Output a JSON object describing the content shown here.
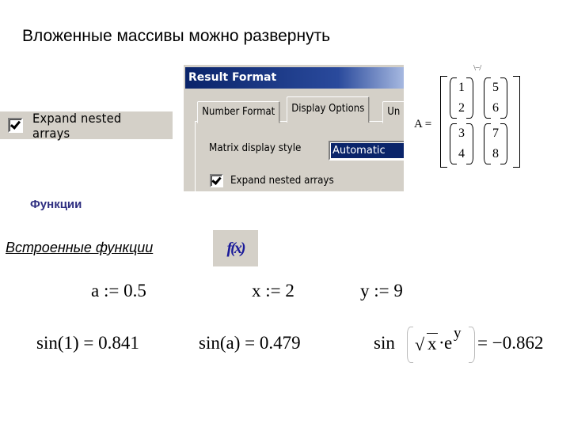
{
  "slide": {
    "title": "Вложенные массивы можно развернуть"
  },
  "left_checkbox": {
    "label": "Expand nested arrays",
    "checked": true
  },
  "dialog": {
    "title": "Result Format",
    "tabs": [
      {
        "label": "Number Format",
        "active": false
      },
      {
        "label": "Display Options",
        "active": true
      },
      {
        "label": "Un",
        "active": false
      }
    ],
    "matrix_style_label": "Matrix display style",
    "matrix_style_value": "Automatic",
    "expand_label": "Expand nested arrays",
    "expand_checked": true
  },
  "matrix": {
    "label": "A =",
    "top_fragment": "\\−/",
    "cells": [
      [
        "1",
        "2"
      ],
      [
        "5",
        "6"
      ],
      [
        "3",
        "4"
      ],
      [
        "7",
        "8"
      ]
    ]
  },
  "section": {
    "title": "Функции"
  },
  "builtin": {
    "title": "Встроенные функции",
    "button_glyph": "f(x)",
    "button_icon": "insert-function-icon"
  },
  "math": {
    "assign_a": "a := 0.5",
    "assign_x": "x := 2",
    "assign_y": "y := 9",
    "sin1": "sin(1) = 0.841",
    "sina": "sin(a) = 0.479",
    "sin3_fn": "sin",
    "sin3_sqrt": "√",
    "sin3_rad": "x",
    "sin3_dot": "·",
    "sin3_e": "e",
    "sin3_sup": "y",
    "sin3_result": "= −0.862"
  },
  "colors": {
    "dialog_bg": "#d4d0c8",
    "title_bar": "#0a246a",
    "section_title": "#2e2e80",
    "fx_glyph": "#1a1a9a"
  }
}
